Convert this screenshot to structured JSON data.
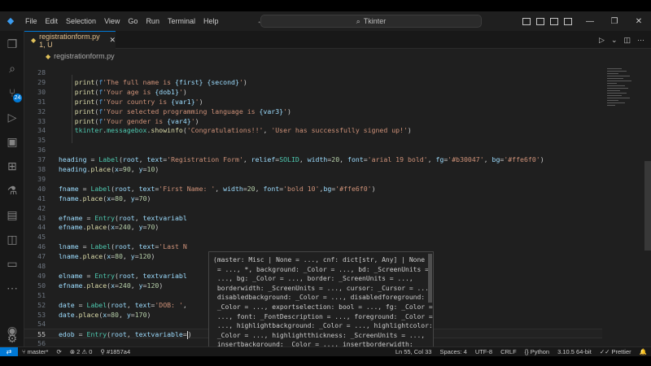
{
  "titlebar": {
    "menus": [
      "File",
      "Edit",
      "Selection",
      "View",
      "Go",
      "Run",
      "Terminal",
      "Help"
    ],
    "search_text": "Tkinter",
    "nav_back": "←",
    "nav_forward": "→"
  },
  "activity": {
    "scm_badge": "24"
  },
  "tab": {
    "label": "registrationform.py 1, U"
  },
  "breadcrumb": "registrationform.py",
  "code_lines": [
    {
      "n": "28",
      "text": ""
    },
    {
      "n": "29",
      "text": "    print(f'The full name is {first} {second}')"
    },
    {
      "n": "30",
      "text": "    print(f'Your age is {dob1}')"
    },
    {
      "n": "31",
      "text": "    print(f'Your country is {var1}')"
    },
    {
      "n": "32",
      "text": "    print(f'Your selected programming language is {var3}')"
    },
    {
      "n": "33",
      "text": "    print(f'Your gender is {var4}')"
    },
    {
      "n": "34",
      "text": "    tkinter.messagebox.showinfo('Congratulations!!', 'User has successfully signed up!')"
    },
    {
      "n": "35",
      "text": ""
    },
    {
      "n": "36",
      "text": ""
    },
    {
      "n": "37",
      "text": "heading = Label(root, text='Registration Form', relief=SOLID, width=20, font='arial 19 bold', fg='#b30047', bg='#ffe6f0')"
    },
    {
      "n": "38",
      "text": "heading.place(x=90, y=10)"
    },
    {
      "n": "39",
      "text": ""
    },
    {
      "n": "40",
      "text": "fname = Label(root, text='First Name: ', width=20, font='bold 10',bg='#ffe6f0')"
    },
    {
      "n": "41",
      "text": "fname.place(x=80, y=70)"
    },
    {
      "n": "42",
      "text": ""
    },
    {
      "n": "43",
      "text": "efname = Entry(root, textvariabl"
    },
    {
      "n": "44",
      "text": "efname.place(x=240, y=70)"
    },
    {
      "n": "45",
      "text": ""
    },
    {
      "n": "46",
      "text": "lname = Label(root, text='Last N"
    },
    {
      "n": "47",
      "text": "lname.place(x=80, y=120)"
    },
    {
      "n": "48",
      "text": ""
    },
    {
      "n": "49",
      "text": "elname = Entry(root, textvariabl"
    },
    {
      "n": "50",
      "text": "efname.place(x=240, y=120)"
    },
    {
      "n": "51",
      "text": ""
    },
    {
      "n": "52",
      "text": "date = Label(root, text='DOB: ',"
    },
    {
      "n": "53",
      "text": "date.place(x=80, y=170)"
    },
    {
      "n": "54",
      "text": ""
    },
    {
      "n": "55",
      "text": "edob = Entry(root, textvariable=)"
    },
    {
      "n": "56",
      "text": ""
    }
  ],
  "current_line": "55",
  "hover_popup": [
    "(master: Misc | None = ..., cnf: dict[str, Any] | None",
    " = ..., *, background: _Color = ..., bd: _ScreenUnits =",
    " ..., bg: _Color = ..., border: _ScreenUnits = ...,",
    " borderwidth: _ScreenUnits = ..., cursor: _Cursor = ...,",
    " disabledbackground: _Color = ..., disabledforeground:",
    " _Color = ..., exportselection: bool = ..., fg: _Color =",
    " ..., font: _FontDescription = ..., foreground: _Color =",
    " ..., highlightbackground: _Color = ..., highlightcolor:",
    " _Color = ..., highlightthickness: _ScreenUnits = ...,",
    " insertbackground: _Color = ..., insertborderwidth:",
    " _ScreenUnits = ..., insertofftime: int = ...,",
    " insertontime: int = ..., insertwidth: _ScreenUnits =",
    " ..., invalidcommand: _EntryValidateCommand = ...,"
  ],
  "status": {
    "branch": "master*",
    "errors": "2",
    "warnings": "0",
    "ref": "#1857a4",
    "position": "Ln 55, Col 33",
    "spaces": "Spaces: 4",
    "encoding": "UTF-8",
    "eol": "CRLF",
    "language": "Python",
    "interpreter": "3.10.5 64-bit",
    "formatter": "Prettier"
  },
  "colors": {
    "accent": "#0078d4",
    "keyword": "#569cd6",
    "function": "#dcdcaa",
    "string": "#ce9178",
    "class": "#4ec9b0",
    "param": "#9cdcfe",
    "number": "#b5cea8"
  }
}
